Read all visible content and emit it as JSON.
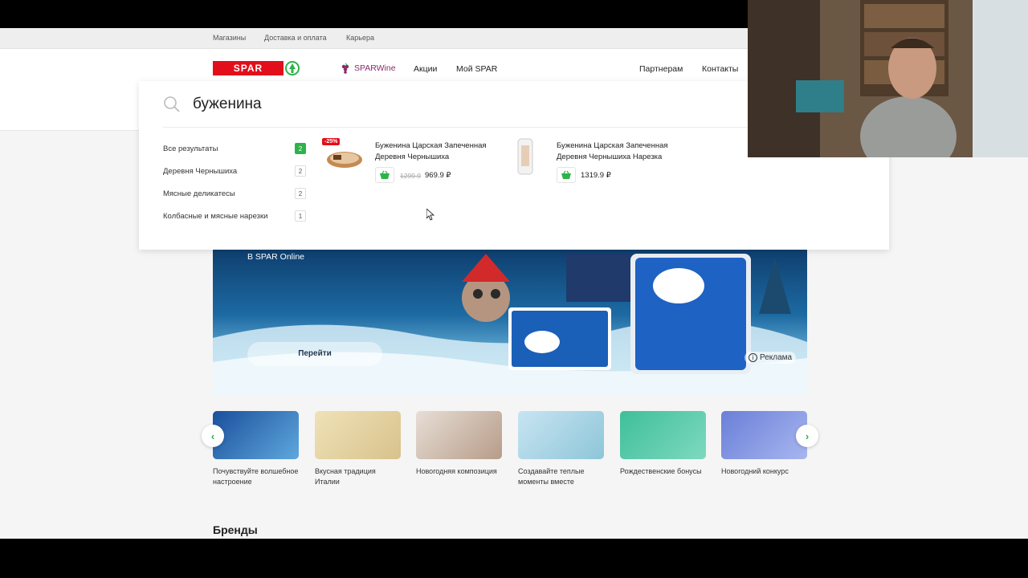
{
  "util_bar": {
    "links": [
      "Магазины",
      "Доставка и оплата",
      "Карьера"
    ]
  },
  "header": {
    "logo_text": "SPAR",
    "nav": {
      "wine": "SPARWine",
      "promo": "Акции",
      "my_spar": "Мой SPAR",
      "partners": "Партнерам",
      "contacts": "Контакты"
    }
  },
  "search": {
    "query": "буженина",
    "categories": [
      {
        "label": "Все результаты",
        "count": "2",
        "active": true
      },
      {
        "label": "Деревня Чернышиха",
        "count": "2",
        "active": false
      },
      {
        "label": "Мясные деликатесы",
        "count": "2",
        "active": false
      },
      {
        "label": "Колбасные и мясные нарезки",
        "count": "1",
        "active": false
      }
    ],
    "products": [
      {
        "name": "Буженина Царская Запеченная Деревня Чернышиха",
        "discount": "-25%",
        "old_price": "1299.9",
        "price": "969.9 ₽"
      },
      {
        "name": "Буженина Царская Запеченная Деревня Чернышиха Нарезка",
        "price": "1319.9 ₽"
      }
    ]
  },
  "banner": {
    "subtitle": "В SPAR Online",
    "button": "Перейти",
    "ad_label": "Реклама"
  },
  "carousel": {
    "items": [
      {
        "label": "Почувствуйте волшебное настроение"
      },
      {
        "label": "Вкусная традиция Италии"
      },
      {
        "label": "Новогодняя композиция"
      },
      {
        "label": "Создавайте теплые моменты вместе"
      },
      {
        "label": "Рождественские бонусы"
      },
      {
        "label": "Новогодний конкурс"
      }
    ],
    "prev_icon": "‹",
    "next_icon": "›"
  },
  "brands": {
    "title": "Бренды"
  },
  "colors": {
    "brand_red": "#e20f1b",
    "brand_green": "#2db34a",
    "wine": "#8b2a6a"
  }
}
